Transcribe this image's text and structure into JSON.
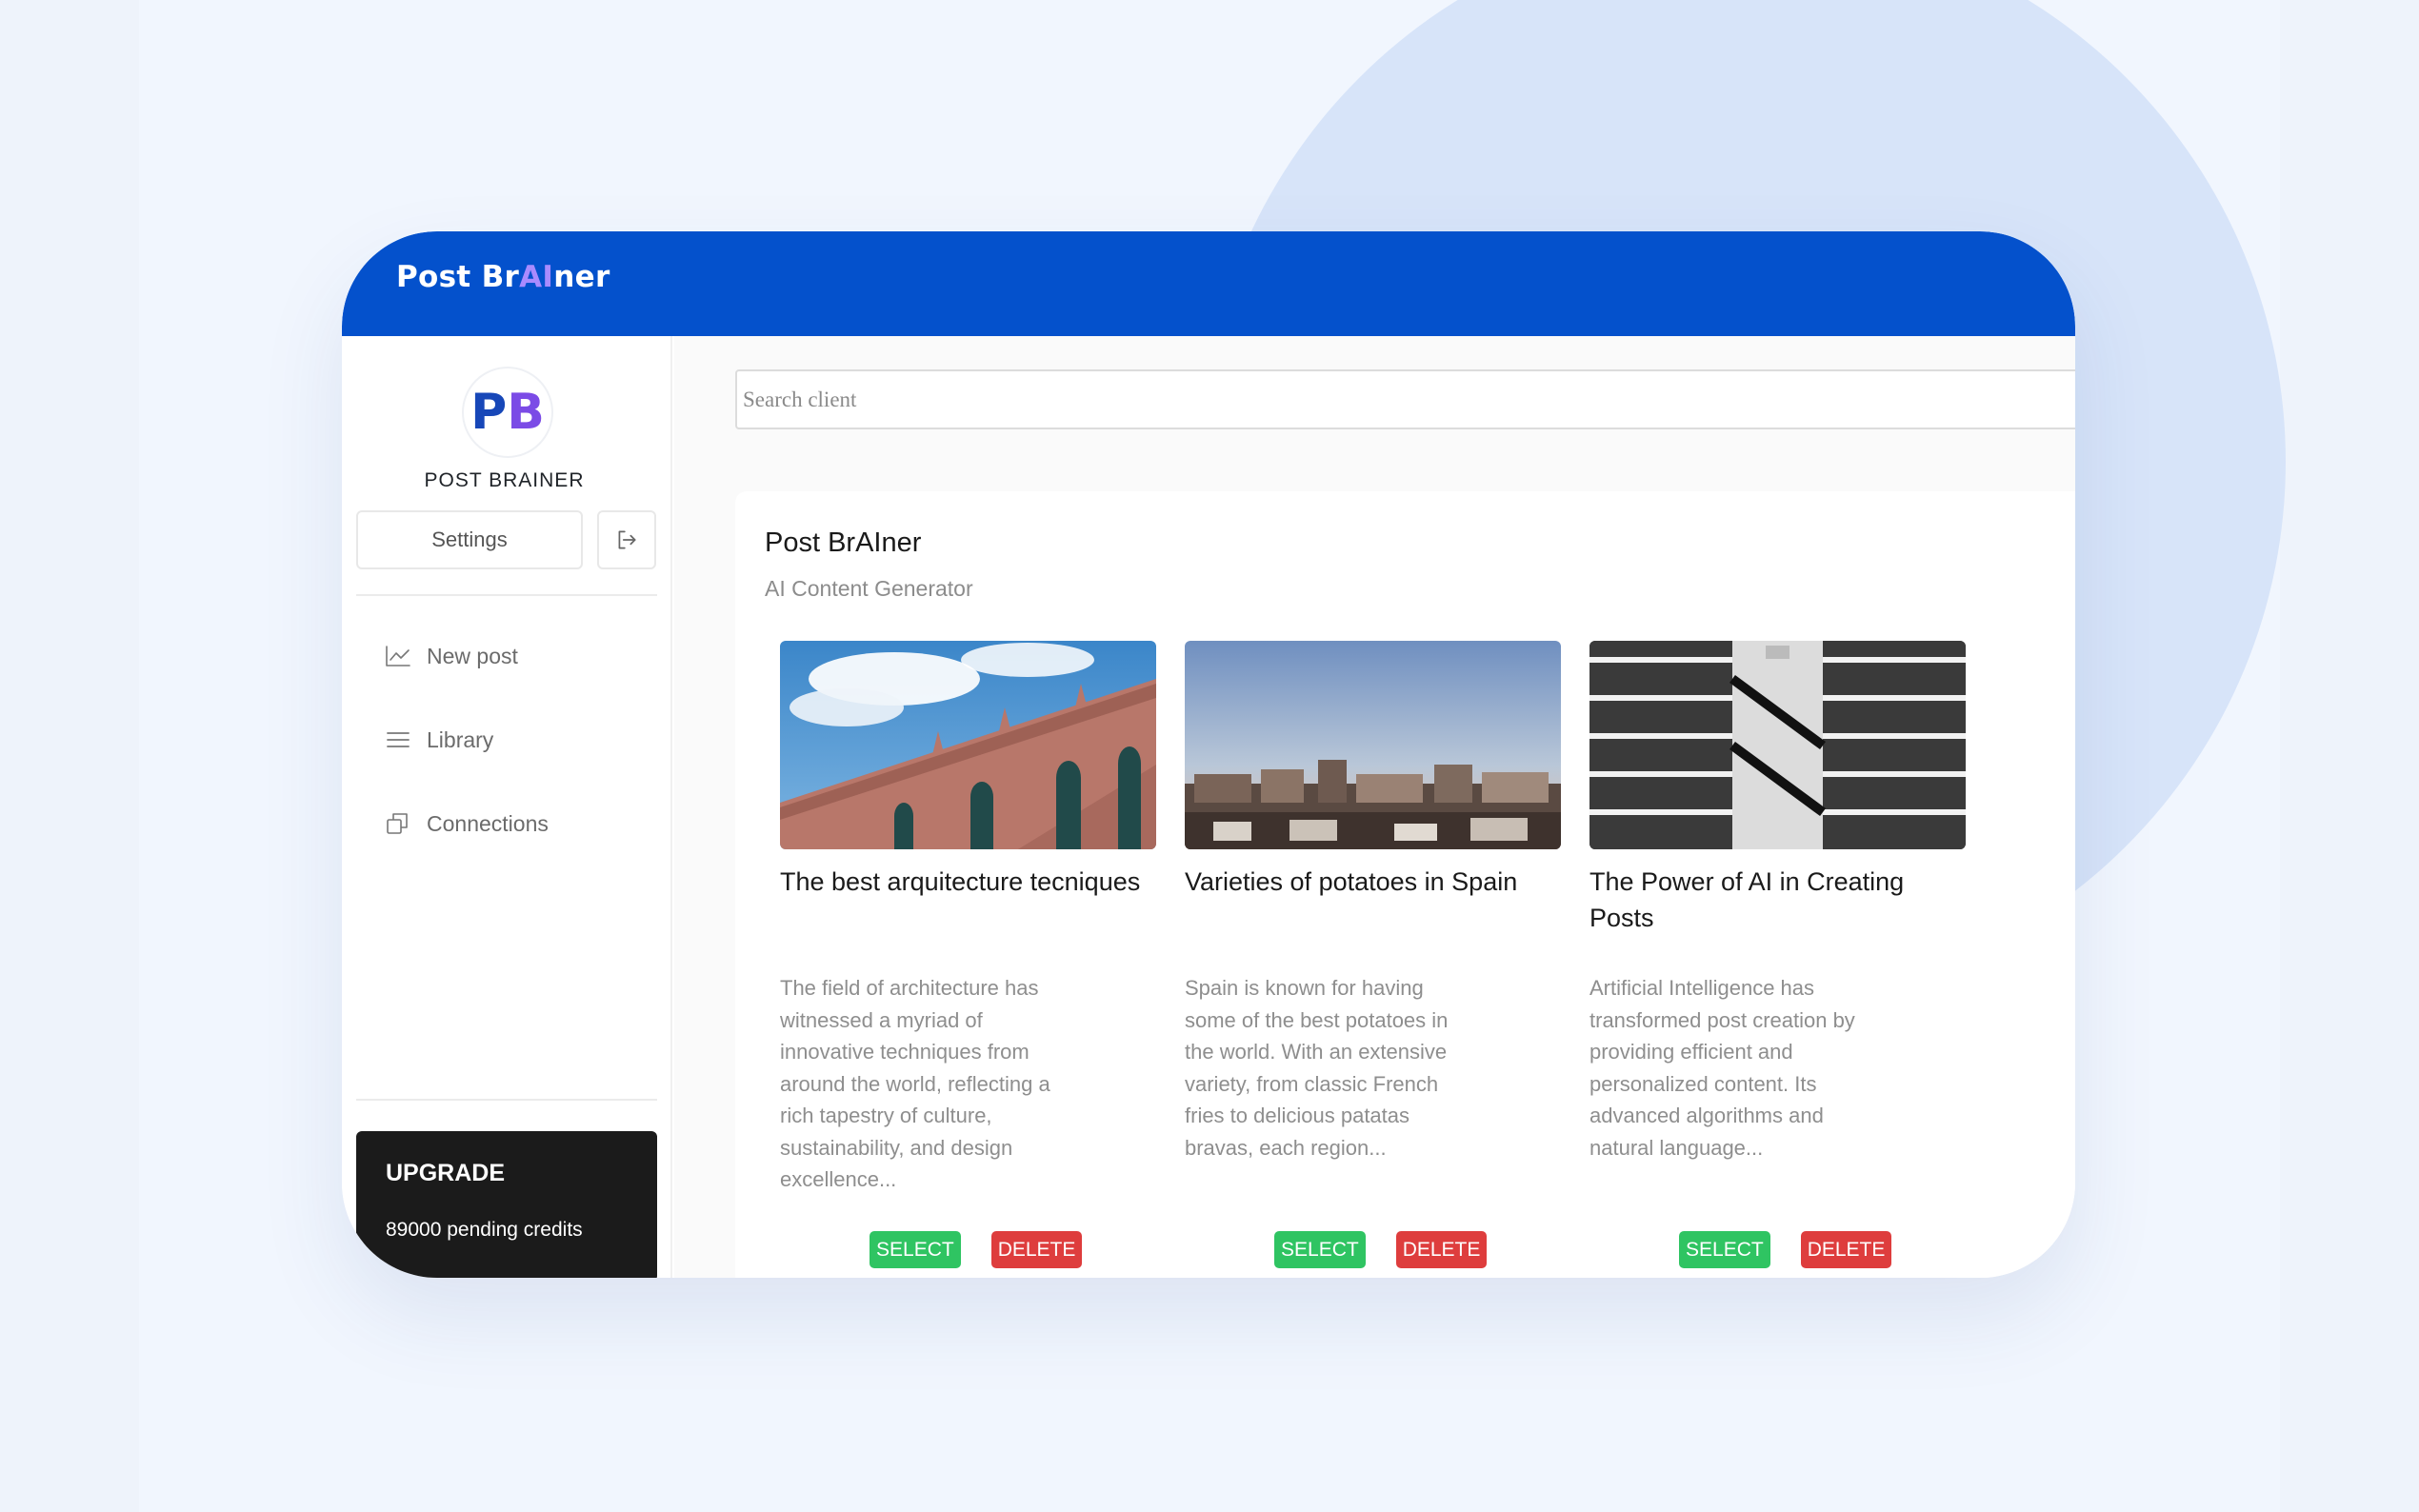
{
  "app": {
    "brand_prefix": "Post Br",
    "brand_ai": "AI",
    "brand_suffix": "ner",
    "accent": "#0451cc"
  },
  "sidebar": {
    "avatar_p": "P",
    "avatar_b": "B",
    "name": "POST BRAINER",
    "settings_label": "Settings",
    "logout_icon": "logout-icon",
    "items": [
      {
        "label": "New post",
        "icon": "chart-line-icon"
      },
      {
        "label": "Library",
        "icon": "list-icon"
      },
      {
        "label": "Connections",
        "icon": "copy-icon"
      }
    ],
    "upgrade": {
      "title": "UPGRADE",
      "credits": "89000 pending credits"
    }
  },
  "main": {
    "search_placeholder": "Search client",
    "card": {
      "title": "Post BrAIner",
      "subtitle": "AI Content Generator"
    },
    "posts": [
      {
        "title": "The best arquitecture tecniques",
        "description": "The field of architecture has witnessed a myriad of innovative techniques from around the world, reflecting a rich tapestry of culture, sustainability, and design excellence...",
        "image": "building-facade-sky",
        "select_label": "SELECT",
        "delete_label": "DELETE"
      },
      {
        "title": "Varieties of potatoes in Spain",
        "description": "Spain is known for having some of the best potatoes in the world. With an extensive variety, from classic French fries to delicious patatas bravas, each region...",
        "image": "spanish-town-skyline",
        "select_label": "SELECT",
        "delete_label": "DELETE"
      },
      {
        "title": "The Power of AI in Creating Posts",
        "description": "Artificial Intelligence has transformed post creation by providing efficient and personalized content. Its advanced algorithms and natural language...",
        "image": "atrium-escalators-bw",
        "select_label": "SELECT",
        "delete_label": "DELETE"
      }
    ]
  }
}
